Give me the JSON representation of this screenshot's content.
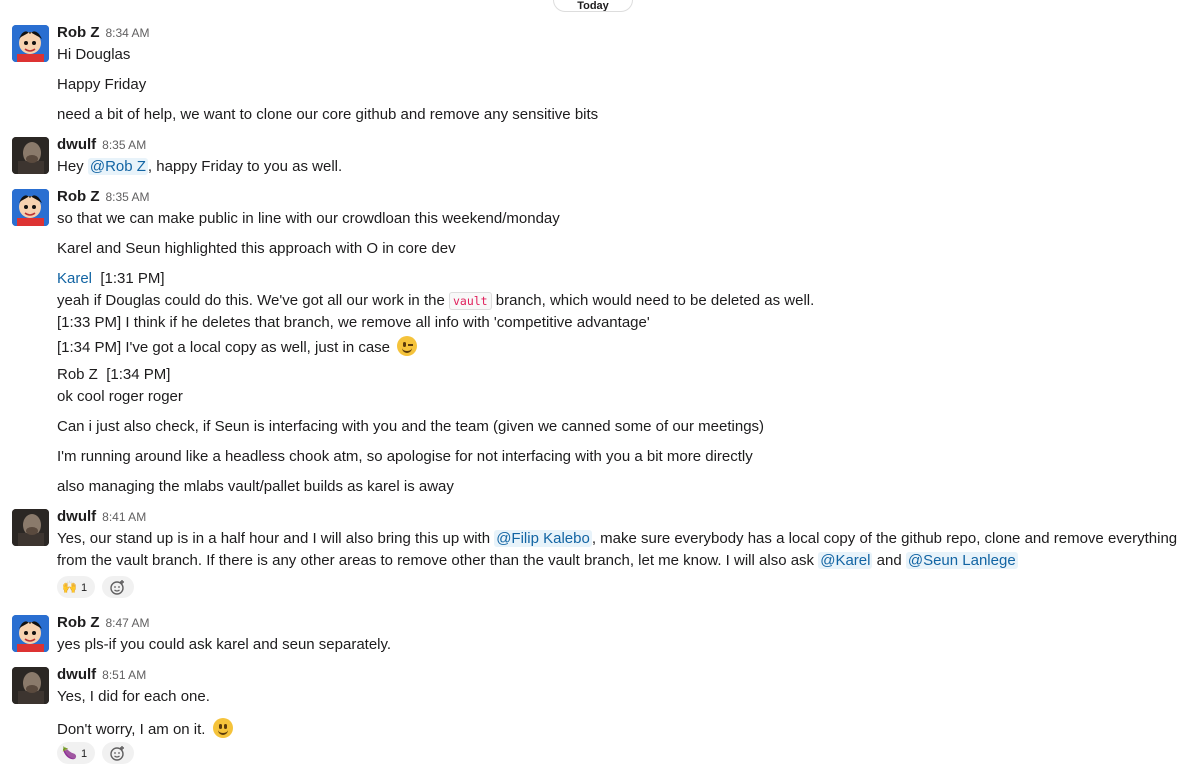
{
  "day_divider": "Today",
  "messages": {
    "m1": {
      "name": "Rob Z",
      "time": "8:34 AM",
      "lines": [
        "Hi Douglas",
        "Happy Friday",
        "need a bit of help, we want to clone our core github and remove any sensitive bits"
      ]
    },
    "m2": {
      "name": "dwulf",
      "time": "8:35 AM",
      "pre": "Hey ",
      "mention": "@Rob Z",
      "post": ", happy Friday to you as well."
    },
    "m3": {
      "name": "Rob Z",
      "time": "8:35 AM",
      "lines": [
        "so that we can make public in line with our crowdloan this weekend/monday",
        "Karel and Seun highlighted this approach with O in core dev"
      ],
      "quote1": {
        "author": "Karel",
        "time": "[1:31 PM]",
        "l1_pre": "yeah if Douglas could do this. We've got all our work in the ",
        "l1_code": "vault",
        "l1_post": " branch, which would need to be deleted as well.",
        "l2": "[1:33 PM] I think if he deletes that branch, we remove all info with 'competitive advantage'",
        "l3": "[1:34 PM] I've got a local copy as well, just in case"
      },
      "quote2": {
        "author": "Rob Z",
        "time": "[1:34 PM]",
        "line": "ok cool roger roger"
      },
      "more": [
        "Can i just also check, if Seun is interfacing with you and the team (given we canned some of our meetings)",
        "I'm running around like a headless chook atm, so apologise for not interfacing with you a bit more directly",
        "also managing the mlabs vault/pallet builds as karel is away"
      ]
    },
    "m4": {
      "name": "dwulf",
      "time": "8:41 AM",
      "l1_pre": "Yes, our stand up is in a half hour and I will also bring this up with ",
      "l1_mention": "@Filip Kalebo",
      "l1_post": ", make sure everybody has a local copy of the github repo, clone and remove everything",
      "l2_pre": "from the vault branch.  If there is any other areas to remove other than the vault branch, let me know.  I will also ask ",
      "l2_mention1": "@Karel",
      "l2_and": " and ",
      "l2_mention2": "@Seun Lanlege",
      "reaction": {
        "emoji": "🙌",
        "count": "1"
      },
      "add_reaction_icon": "add-reaction-icon"
    },
    "m5": {
      "name": "Rob Z",
      "time": "8:47 AM",
      "line": "yes pls-if you could ask karel and seun separately."
    },
    "m6": {
      "name": "dwulf",
      "time": "8:51 AM",
      "lines": [
        "Yes, I did for each one.",
        "Don't worry, I am on it."
      ],
      "reaction": {
        "emoji": "🍆",
        "count": "1"
      }
    }
  },
  "colors": {
    "mention": "#1264a3",
    "code": "#e01e5a",
    "text": "#1d1c1d",
    "meta": "#616061"
  }
}
